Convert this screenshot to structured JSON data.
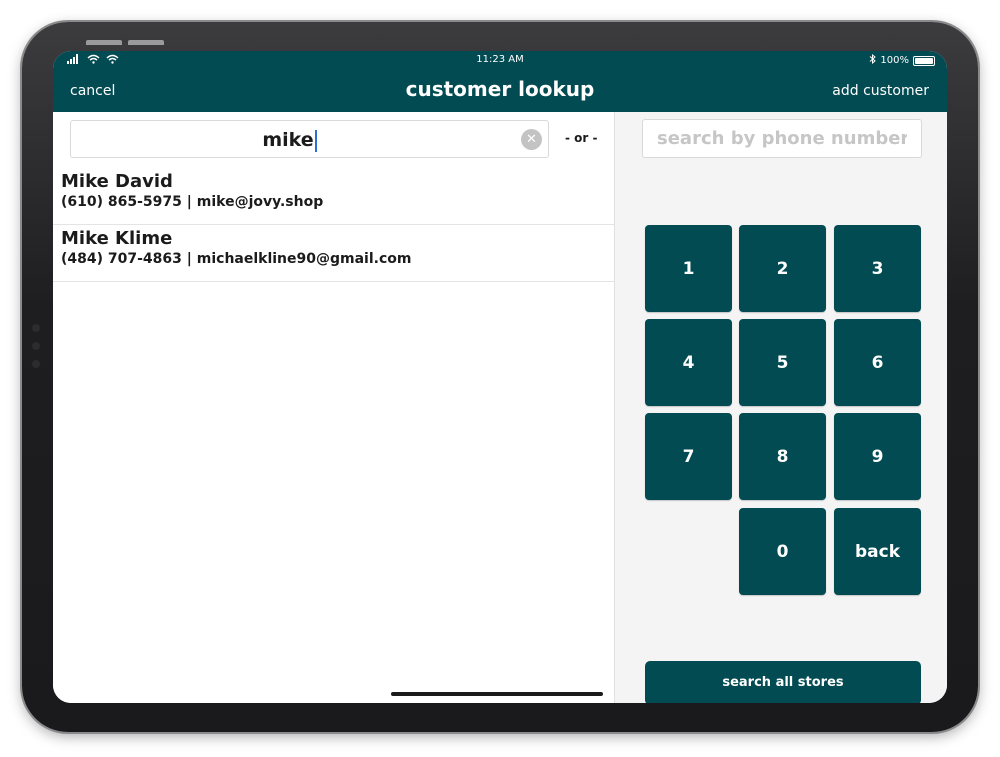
{
  "status_bar": {
    "time": "11:23 AM",
    "battery": "100%",
    "battery_level": 1.0,
    "icons": [
      "signal-icon",
      "wifi-icon",
      "wifi-icon",
      "bluetooth-icon",
      "battery-icon"
    ]
  },
  "nav": {
    "cancel": "cancel",
    "title": "customer lookup",
    "add_customer": "add customer"
  },
  "search": {
    "value": "mike",
    "clear_icon": "✕",
    "separator": "- or -"
  },
  "results": [
    {
      "name": "Mike David",
      "details": "(610) 865-5975 | mike@jovy.shop"
    },
    {
      "name": "Mike Klime",
      "details": "(484) 707-4863 | michaelkline90@gmail.com"
    }
  ],
  "phone": {
    "placeholder": "search by phone number",
    "value": ""
  },
  "keypad": {
    "keys": [
      "1",
      "2",
      "3",
      "4",
      "5",
      "6",
      "7",
      "8",
      "9",
      "0",
      "back"
    ]
  },
  "search_all": "search all stores",
  "colors": {
    "brand": "#024b52",
    "panel_bg": "#f4f4f4",
    "text": "#1b1b1b",
    "caret": "#2a6fd6"
  }
}
